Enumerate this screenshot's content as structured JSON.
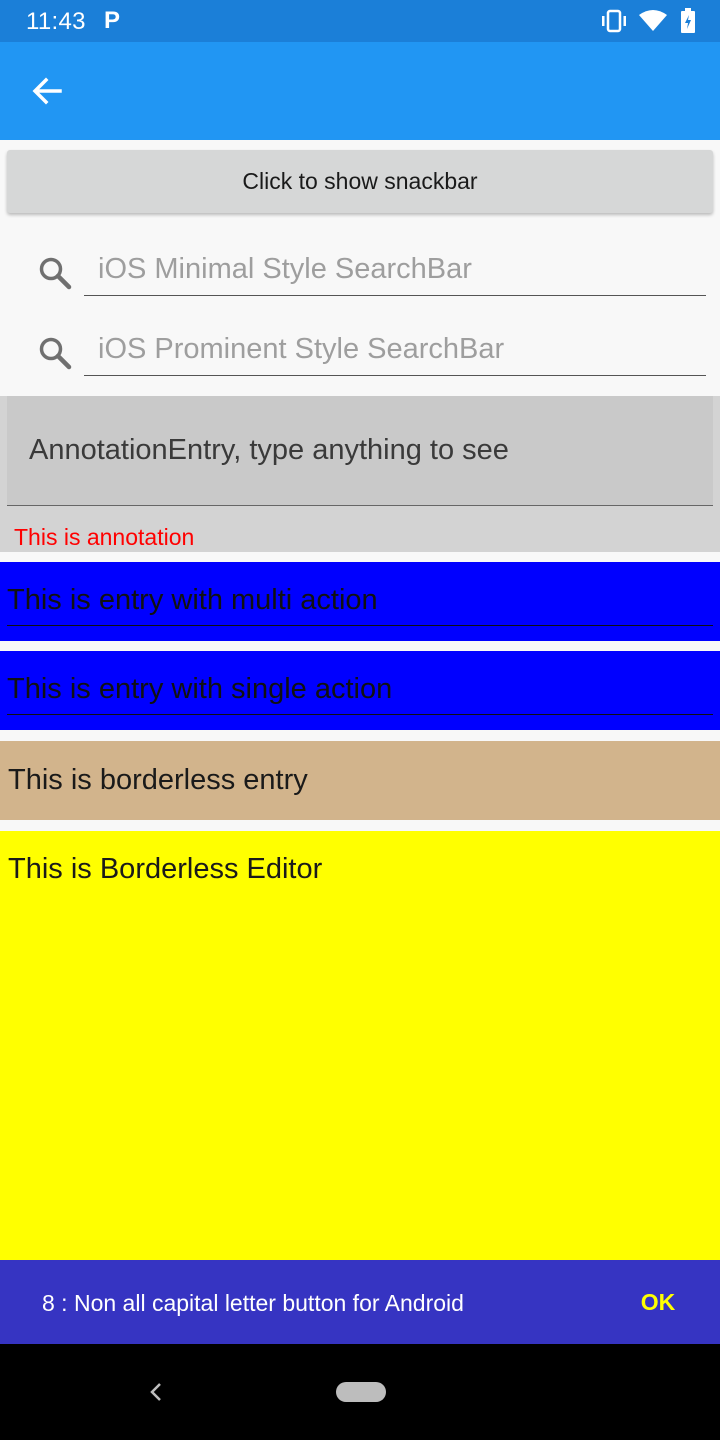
{
  "status_bar": {
    "time": "11:43",
    "notification_icon": "P",
    "icons": [
      "vibrate-icon",
      "wifi-icon",
      "battery-icon"
    ]
  },
  "app_bar": {
    "back_icon": "arrow-back-icon",
    "color": "#2196f3"
  },
  "snackbar_button": {
    "label": "Click to show snackbar"
  },
  "search_minimal": {
    "placeholder": "iOS Minimal Style SearchBar",
    "icon": "search-icon"
  },
  "search_prominent": {
    "placeholder": "iOS Prominent Style SearchBar",
    "icon": "search-icon"
  },
  "annotation_entry": {
    "placeholder": "AnnotationEntry, type anything to see",
    "annotation": "This is annotation",
    "annotation_color": "#ff0000"
  },
  "multi_action_entry": {
    "placeholder": "This is entry with multi action",
    "background": "#0000ff"
  },
  "single_action_entry": {
    "placeholder": "This is entry with single action",
    "background": "#0000ff"
  },
  "borderless_entry": {
    "placeholder": "This is borderless entry",
    "background": "#d2b48c"
  },
  "borderless_editor": {
    "placeholder": "This is Borderless Editor",
    "background": "#ffff00"
  },
  "snackbar": {
    "message": "8 : Non all capital letter button for Android",
    "action_label": "OK",
    "background": "#3634c2",
    "action_color": "#ffff00"
  },
  "nav_bar": {
    "icons": [
      "nav-back-icon",
      "home-pill-icon"
    ]
  }
}
